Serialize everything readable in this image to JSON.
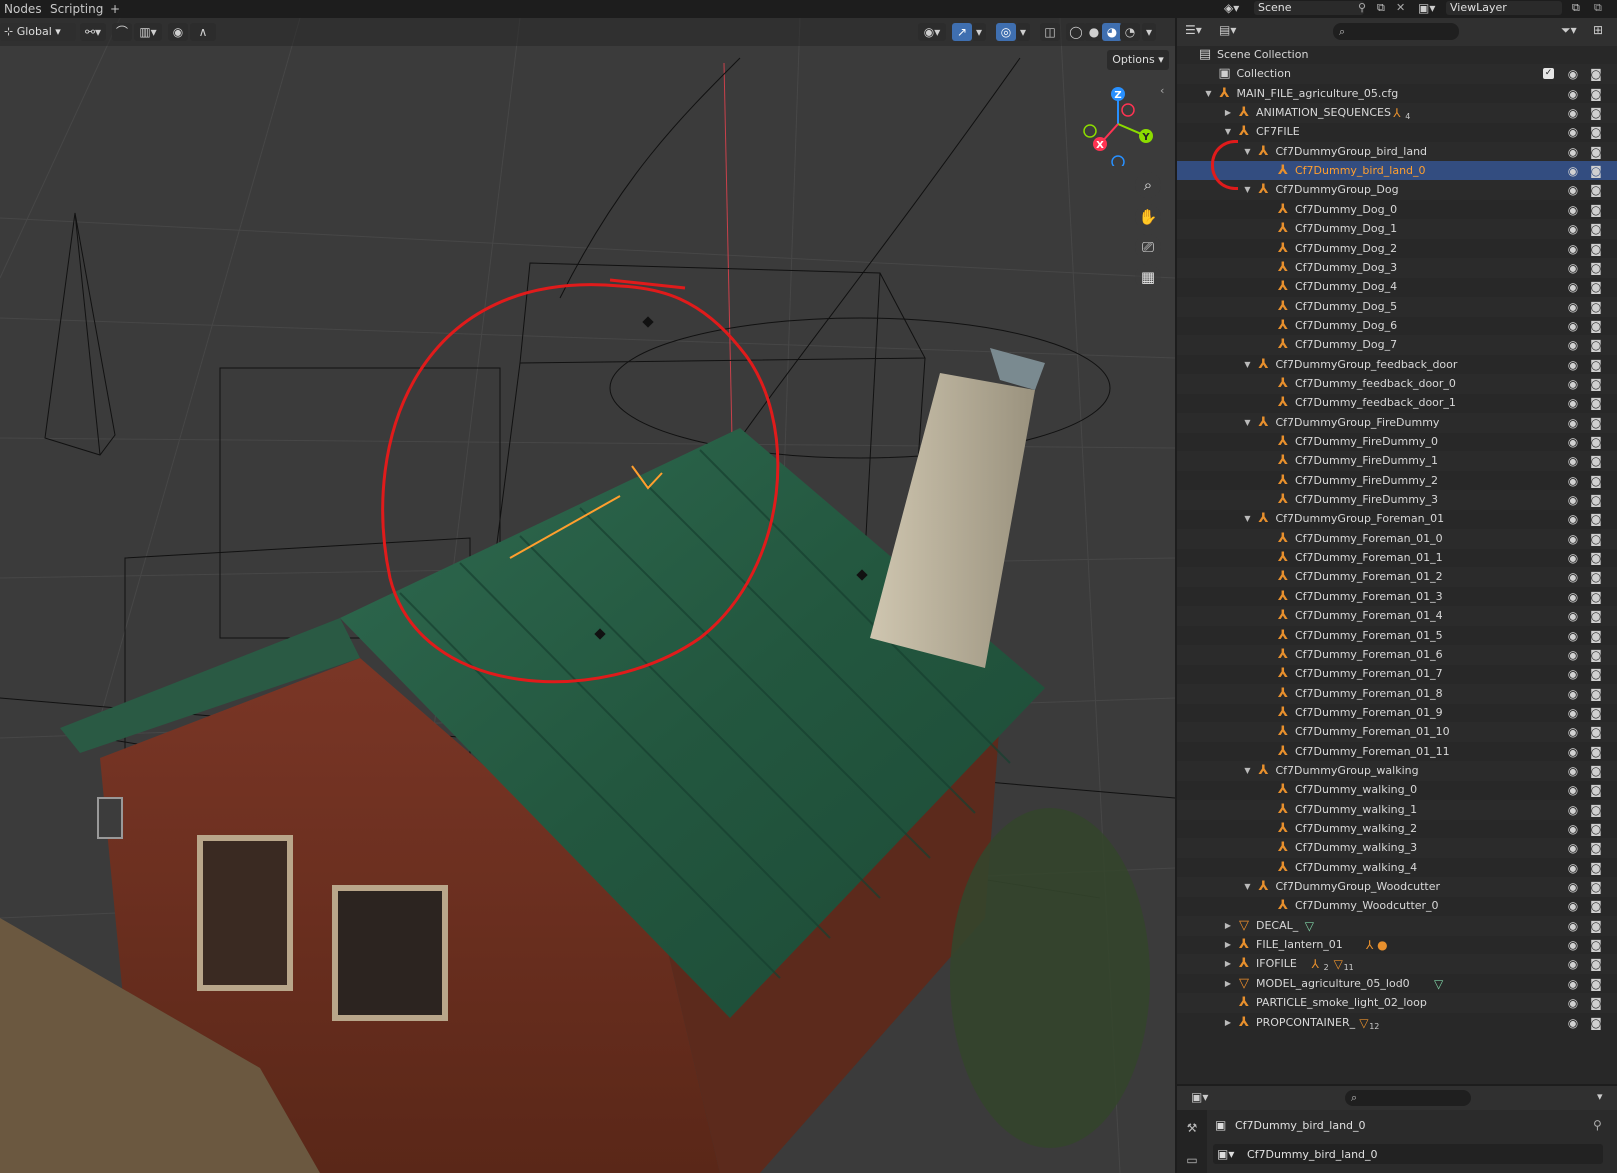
{
  "topbar": {
    "tabs": [
      "Nodes",
      "Scripting"
    ],
    "add_tab": "+",
    "scene_label": "Scene",
    "view_layer_label": "ViewLayer"
  },
  "viewport": {
    "transform_orientation": "Global",
    "options_label": "Options",
    "gizmo_labels": {
      "z": "Z",
      "y": "Y",
      "x": "X"
    },
    "colors": {
      "axis_x": "#ff3352",
      "axis_y": "#8bdc00",
      "axis_z": "#2890ff",
      "annotation": "#e01b1b",
      "selection": "#ff9f2e"
    }
  },
  "outliner": {
    "search_placeholder": "",
    "rows": [
      {
        "label": "Scene Collection",
        "depth": 0,
        "icon": "scene-collection",
        "tri": ""
      },
      {
        "label": "Collection",
        "depth": 1,
        "icon": "collection",
        "tri": "",
        "check": true
      },
      {
        "label": "MAIN_FILE_agriculture_05.cfg",
        "depth": 1,
        "icon": "empty",
        "tri": "▼"
      },
      {
        "label": "ANIMATION_SEQUENCES",
        "depth": 2,
        "icon": "empty",
        "tri": "▶",
        "badge": "4"
      },
      {
        "label": "CF7FILE",
        "depth": 2,
        "icon": "empty",
        "tri": "▼"
      },
      {
        "label": "Cf7DummyGroup_bird_land",
        "depth": 3,
        "icon": "empty",
        "tri": "▼"
      },
      {
        "label": "Cf7Dummy_bird_land_0",
        "depth": 4,
        "icon": "empty",
        "tri": "",
        "selected": true
      },
      {
        "label": "Cf7DummyGroup_Dog",
        "depth": 3,
        "icon": "empty",
        "tri": "▼"
      },
      {
        "label": "Cf7Dummy_Dog_0",
        "depth": 4,
        "icon": "empty",
        "tri": ""
      },
      {
        "label": "Cf7Dummy_Dog_1",
        "depth": 4,
        "icon": "empty",
        "tri": ""
      },
      {
        "label": "Cf7Dummy_Dog_2",
        "depth": 4,
        "icon": "empty",
        "tri": ""
      },
      {
        "label": "Cf7Dummy_Dog_3",
        "depth": 4,
        "icon": "empty",
        "tri": ""
      },
      {
        "label": "Cf7Dummy_Dog_4",
        "depth": 4,
        "icon": "empty",
        "tri": ""
      },
      {
        "label": "Cf7Dummy_Dog_5",
        "depth": 4,
        "icon": "empty",
        "tri": ""
      },
      {
        "label": "Cf7Dummy_Dog_6",
        "depth": 4,
        "icon": "empty",
        "tri": ""
      },
      {
        "label": "Cf7Dummy_Dog_7",
        "depth": 4,
        "icon": "empty",
        "tri": ""
      },
      {
        "label": "Cf7DummyGroup_feedback_door",
        "depth": 3,
        "icon": "empty",
        "tri": "▼"
      },
      {
        "label": "Cf7Dummy_feedback_door_0",
        "depth": 4,
        "icon": "empty",
        "tri": ""
      },
      {
        "label": "Cf7Dummy_feedback_door_1",
        "depth": 4,
        "icon": "empty",
        "tri": ""
      },
      {
        "label": "Cf7DummyGroup_FireDummy",
        "depth": 3,
        "icon": "empty",
        "tri": "▼"
      },
      {
        "label": "Cf7Dummy_FireDummy_0",
        "depth": 4,
        "icon": "empty",
        "tri": ""
      },
      {
        "label": "Cf7Dummy_FireDummy_1",
        "depth": 4,
        "icon": "empty",
        "tri": ""
      },
      {
        "label": "Cf7Dummy_FireDummy_2",
        "depth": 4,
        "icon": "empty",
        "tri": ""
      },
      {
        "label": "Cf7Dummy_FireDummy_3",
        "depth": 4,
        "icon": "empty",
        "tri": ""
      },
      {
        "label": "Cf7DummyGroup_Foreman_01",
        "depth": 3,
        "icon": "empty",
        "tri": "▼"
      },
      {
        "label": "Cf7Dummy_Foreman_01_0",
        "depth": 4,
        "icon": "empty",
        "tri": ""
      },
      {
        "label": "Cf7Dummy_Foreman_01_1",
        "depth": 4,
        "icon": "empty",
        "tri": ""
      },
      {
        "label": "Cf7Dummy_Foreman_01_2",
        "depth": 4,
        "icon": "empty",
        "tri": ""
      },
      {
        "label": "Cf7Dummy_Foreman_01_3",
        "depth": 4,
        "icon": "empty",
        "tri": ""
      },
      {
        "label": "Cf7Dummy_Foreman_01_4",
        "depth": 4,
        "icon": "empty",
        "tri": ""
      },
      {
        "label": "Cf7Dummy_Foreman_01_5",
        "depth": 4,
        "icon": "empty",
        "tri": ""
      },
      {
        "label": "Cf7Dummy_Foreman_01_6",
        "depth": 4,
        "icon": "empty",
        "tri": ""
      },
      {
        "label": "Cf7Dummy_Foreman_01_7",
        "depth": 4,
        "icon": "empty",
        "tri": ""
      },
      {
        "label": "Cf7Dummy_Foreman_01_8",
        "depth": 4,
        "icon": "empty",
        "tri": ""
      },
      {
        "label": "Cf7Dummy_Foreman_01_9",
        "depth": 4,
        "icon": "empty",
        "tri": ""
      },
      {
        "label": "Cf7Dummy_Foreman_01_10",
        "depth": 4,
        "icon": "empty",
        "tri": ""
      },
      {
        "label": "Cf7Dummy_Foreman_01_11",
        "depth": 4,
        "icon": "empty",
        "tri": ""
      },
      {
        "label": "Cf7DummyGroup_walking",
        "depth": 3,
        "icon": "empty",
        "tri": "▼"
      },
      {
        "label": "Cf7Dummy_walking_0",
        "depth": 4,
        "icon": "empty",
        "tri": ""
      },
      {
        "label": "Cf7Dummy_walking_1",
        "depth": 4,
        "icon": "empty",
        "tri": ""
      },
      {
        "label": "Cf7Dummy_walking_2",
        "depth": 4,
        "icon": "empty",
        "tri": ""
      },
      {
        "label": "Cf7Dummy_walking_3",
        "depth": 4,
        "icon": "empty",
        "tri": ""
      },
      {
        "label": "Cf7Dummy_walking_4",
        "depth": 4,
        "icon": "empty",
        "tri": ""
      },
      {
        "label": "Cf7DummyGroup_Woodcutter",
        "depth": 3,
        "icon": "empty",
        "tri": "▼"
      },
      {
        "label": "Cf7Dummy_Woodcutter_0",
        "depth": 4,
        "icon": "empty",
        "tri": ""
      },
      {
        "label": "DECAL_",
        "depth": 2,
        "icon": "mesh",
        "tri": "▶",
        "badge_icon": "mesh"
      },
      {
        "label": "FILE_lantern_01",
        "depth": 2,
        "icon": "empty",
        "tri": "▶",
        "badge_icon": "empty-light"
      },
      {
        "label": "IFOFILE",
        "depth": 2,
        "icon": "empty",
        "tri": "▶",
        "badge": "2",
        "badge2": "11"
      },
      {
        "label": "MODEL_agriculture_05_lod0",
        "depth": 2,
        "icon": "mesh",
        "tri": "▶",
        "badge_icon": "mesh"
      },
      {
        "label": "PARTICLE_smoke_light_02_loop",
        "depth": 2,
        "icon": "empty",
        "tri": ""
      },
      {
        "label": "PROPCONTAINER_",
        "depth": 2,
        "icon": "empty",
        "tri": "▶",
        "badge2": "12"
      }
    ]
  },
  "properties": {
    "object_name": "Cf7Dummy_bird_land_0",
    "data_name": "Cf7Dummy_bird_land_0"
  }
}
